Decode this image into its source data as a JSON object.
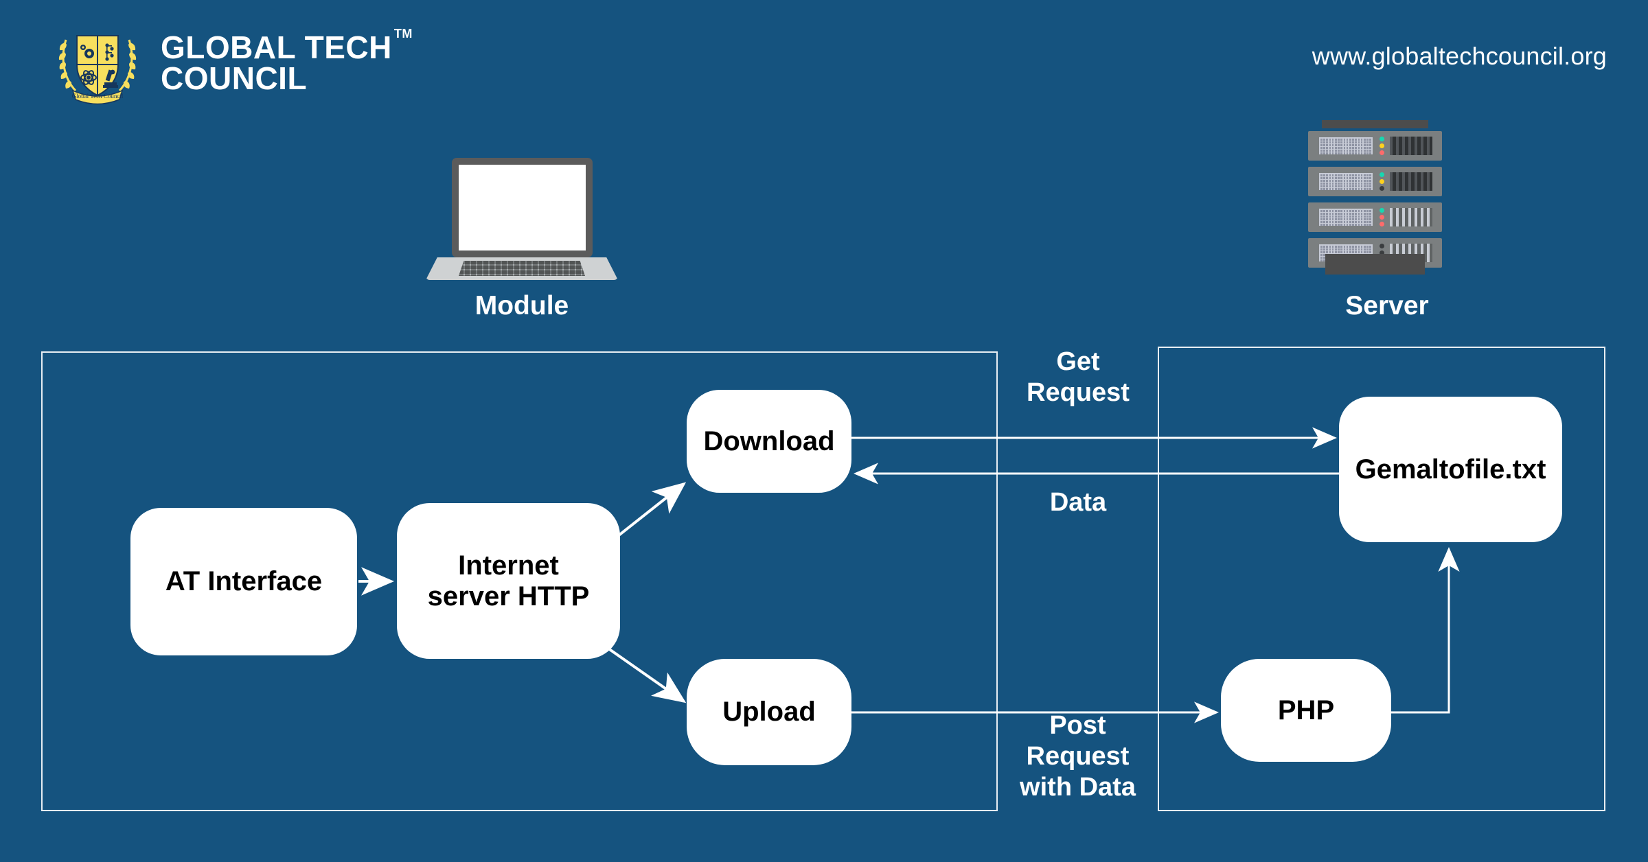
{
  "page": {
    "background_color": "#15537f",
    "accent_white": "#ffffff",
    "logo_gold": "#f7df5e"
  },
  "header": {
    "brand_line1": "GLOBAL TECH",
    "brand_line2": "COUNCIL",
    "trademark": "TM",
    "logo_motto": "Global Tech Council",
    "url": "www.globaltechcouncil.org"
  },
  "devices": [
    {
      "id": "module",
      "label": "Module",
      "icon": "laptop-icon"
    },
    {
      "id": "server",
      "label": "Server",
      "icon": "server-rack-icon"
    }
  ],
  "containers": [
    {
      "id": "module-boundary",
      "label": ""
    },
    {
      "id": "server-boundary",
      "label": ""
    }
  ],
  "nodes": {
    "at_interface": "AT Interface",
    "internet_server_http": "Internet\nserver HTTP",
    "internet_server_http_l1": "Internet",
    "internet_server_http_l2": "server HTTP",
    "download": "Download",
    "upload": "Upload",
    "php": "PHP",
    "file": "Gemaltofile.txt"
  },
  "edge_labels": {
    "get_request_l1": "Get",
    "get_request_l2": "Request",
    "data": "Data",
    "post_l1": "Post",
    "post_l2": "Request",
    "post_l3": "with Data"
  },
  "flow": {
    "type": "diagram",
    "edges": [
      {
        "from": "AT Interface",
        "to": "Internet server HTTP",
        "label": ""
      },
      {
        "from": "Internet server HTTP",
        "to": "Download",
        "label": ""
      },
      {
        "from": "Internet server HTTP",
        "to": "Upload",
        "label": ""
      },
      {
        "from": "Download",
        "to": "Gemaltofile.txt",
        "label": "Get Request"
      },
      {
        "from": "Gemaltofile.txt",
        "to": "Download",
        "label": "Data"
      },
      {
        "from": "Upload",
        "to": "PHP",
        "label": "Post Request with Data"
      },
      {
        "from": "PHP",
        "to": "Gemaltofile.txt",
        "label": ""
      }
    ]
  }
}
